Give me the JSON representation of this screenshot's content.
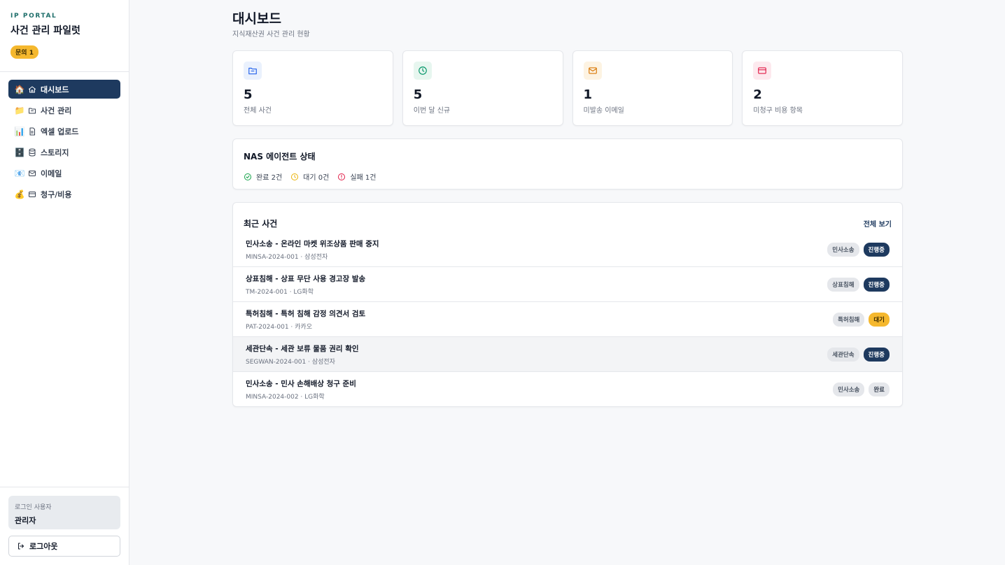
{
  "sidebar": {
    "kicker": "IP PORTAL",
    "title": "사건 관리 파일럿",
    "badge": "문의 1",
    "items": [
      {
        "emoji": "🏠",
        "icon": "home-icon",
        "label": "대시보드",
        "active": true
      },
      {
        "emoji": "📁",
        "icon": "folder-icon",
        "label": "사건 관리",
        "active": false
      },
      {
        "emoji": "📊",
        "icon": "file-icon",
        "label": "엑셀 업로드",
        "active": false
      },
      {
        "emoji": "🗄️",
        "icon": "database-icon",
        "label": "스토리지",
        "active": false
      },
      {
        "emoji": "📧",
        "icon": "mail-icon",
        "label": "이메일",
        "active": false
      },
      {
        "emoji": "💰",
        "icon": "card-icon",
        "label": "청구/비용",
        "active": false
      }
    ],
    "user_label": "로그인 사용자",
    "user_name": "관리자",
    "logout": "로그아웃"
  },
  "header": {
    "title": "대시보드",
    "subtitle": "지식재산권 사건 관리 현황"
  },
  "stats": [
    {
      "value": "5",
      "label": "전체 사건",
      "icon": "folder-icon",
      "color": "#2563eb",
      "bg": "#eaf1fd"
    },
    {
      "value": "5",
      "label": "이번 달 신규",
      "icon": "clock-icon",
      "color": "#059669",
      "bg": "#e7f6ef"
    },
    {
      "value": "1",
      "label": "미발송 이메일",
      "icon": "mail-icon",
      "color": "#d97706",
      "bg": "#fdf3e2"
    },
    {
      "value": "2",
      "label": "미청구 비용 항목",
      "icon": "card-icon",
      "color": "#e11d48",
      "bg": "#fde9ee"
    }
  ],
  "nas": {
    "title": "NAS 에이전트 상태",
    "done": "완료 2건",
    "wait": "대기 0건",
    "fail": "실패 1건",
    "colors": {
      "done": "#16a34a",
      "wait": "#eab308",
      "fail": "#e11d48"
    }
  },
  "recent": {
    "title": "최근 사건",
    "view_all": "전체 보기",
    "rows": [
      {
        "title": "민사소송 - 온라인 마켓 위조상품 판매 중지",
        "meta": "MINSA-2024-001 · 삼성전자",
        "category": "민사소송",
        "status": "진행중",
        "status_type": "active"
      },
      {
        "title": "상표침해 - 상표 무단 사용 경고장 발송",
        "meta": "TM-2024-001 · LG화학",
        "category": "상표침해",
        "status": "진행중",
        "status_type": "active"
      },
      {
        "title": "특허침해 - 특허 침해 감정 의견서 검토",
        "meta": "PAT-2024-001 · 카카오",
        "category": "특허침해",
        "status": "대기",
        "status_type": "wait"
      },
      {
        "title": "세관단속 - 세관 보류 물품 권리 확인",
        "meta": "SEGWAN-2024-001 · 삼성전자",
        "category": "세관단속",
        "status": "진행중",
        "status_type": "active"
      },
      {
        "title": "민사소송 - 민사 손해배상 청구 준비",
        "meta": "MINSA-2024-002 · LG화학",
        "category": "민사소송",
        "status": "완료",
        "status_type": "done"
      }
    ]
  }
}
